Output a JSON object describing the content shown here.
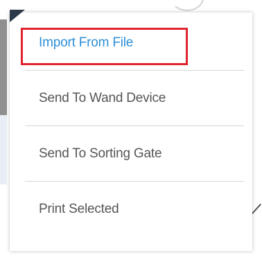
{
  "menu": {
    "items": [
      {
        "label": "Import From File",
        "highlighted": true
      },
      {
        "label": "Send To Wand Device",
        "highlighted": false
      },
      {
        "label": "Send To Sorting Gate",
        "highlighted": false
      },
      {
        "label": "Print Selected",
        "highlighted": false
      }
    ]
  },
  "colors": {
    "active_text": "#2e8fd6",
    "text": "#555555",
    "highlight_border": "#e0232f",
    "divider": "#d6d6d6",
    "corner_tab": "#2d3a4a"
  }
}
